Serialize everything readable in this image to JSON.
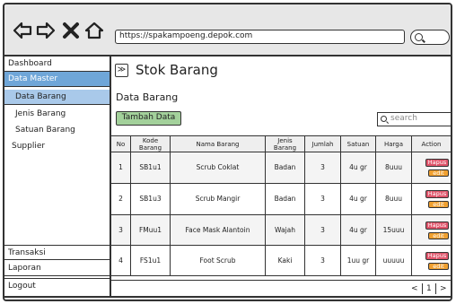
{
  "browser": {
    "url": "https://spakampoeng.depok.com"
  },
  "sidebar": {
    "items": [
      {
        "label": "Dashboard"
      },
      {
        "label": "Data Master"
      },
      {
        "label": "Data Barang"
      },
      {
        "label": "Jenis Barang"
      },
      {
        "label": "Satuan Barang"
      },
      {
        "label": "Supplier"
      },
      {
        "label": "Transaksi"
      },
      {
        "label": "Laporan"
      },
      {
        "label": "Logout"
      }
    ]
  },
  "main": {
    "collapse_symbol": "≫",
    "page_title": "Stok Barang",
    "section_title": "Data Barang",
    "add_button": "Tambah Data",
    "search_placeholder": "search",
    "table": {
      "headers": [
        "No",
        "Kode Barang",
        "Nama Barang",
        "Jenis Barang",
        "Jumlah",
        "Satuan",
        "Harga",
        "Action"
      ],
      "rows": [
        {
          "no": "1",
          "kode": "SB1u1",
          "nama": "Scrub Coklat",
          "jenis": "Badan",
          "jumlah": "3",
          "satuan": "4u gr",
          "harga": "8uuu"
        },
        {
          "no": "2",
          "kode": "SB1u3",
          "nama": "Scrub Mangir",
          "jenis": "Badan",
          "jumlah": "3",
          "satuan": "4u gr",
          "harga": "8uuu"
        },
        {
          "no": "3",
          "kode": "FMuu1",
          "nama": "Face Mask Alantoin",
          "jenis": "Wajah",
          "jumlah": "3",
          "satuan": "4u gr",
          "harga": "15uuu"
        },
        {
          "no": "4",
          "kode": "FS1u1",
          "nama": "Foot Scrub",
          "jenis": "Kaki",
          "jumlah": "3",
          "satuan": "1uu gr",
          "harga": "uuuuu"
        }
      ],
      "action_delete": "Hapus",
      "action_edit": "edit"
    },
    "pagination": {
      "prev": "<",
      "current": "1",
      "next": ">"
    }
  },
  "colors": {
    "sidebar_active": "#6fa6d8",
    "sidebar_sub_active": "#a9c9ea",
    "add_button": "#a3d19b",
    "delete_button": "#e0556b",
    "edit_button": "#f0a030",
    "chrome": "#e7e7e7"
  },
  "icons": [
    "back-arrow-icon",
    "forward-arrow-icon",
    "close-icon",
    "home-icon",
    "search-icon",
    "collapse-icon"
  ]
}
